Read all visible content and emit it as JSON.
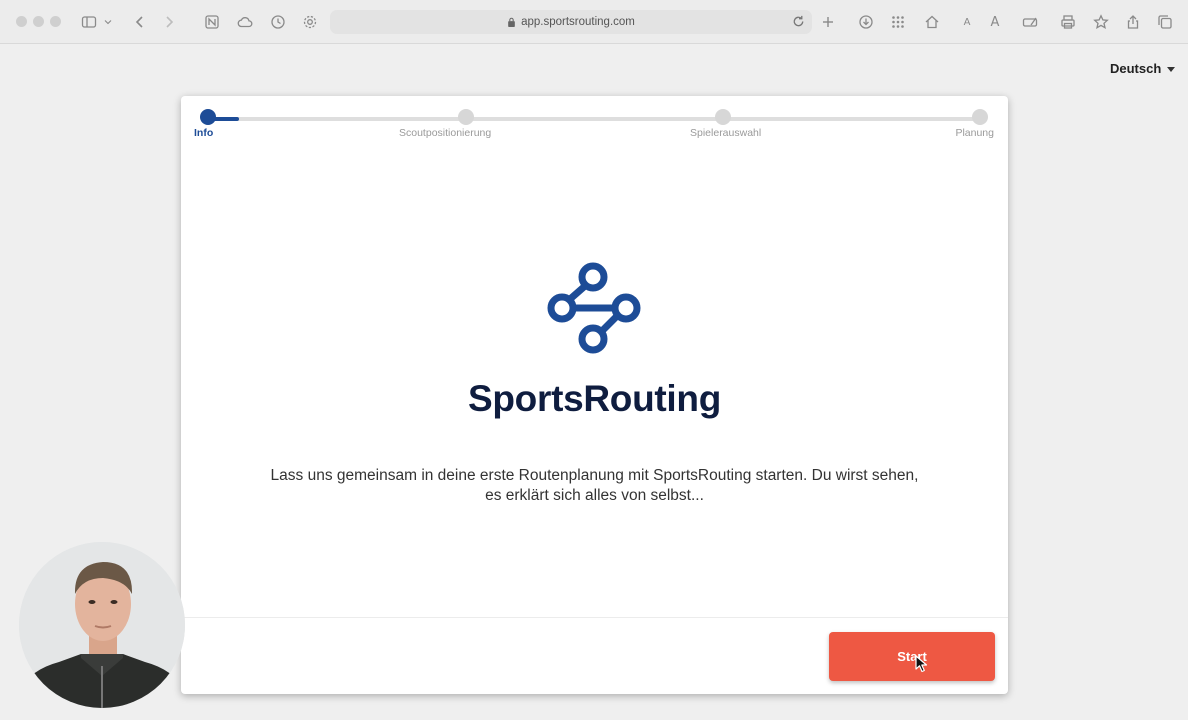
{
  "browser": {
    "url": "app.sportsrouting.com",
    "toolbar_icons": [
      "sidebar-icon",
      "chevron-down-icon",
      "back-icon",
      "forward-icon",
      "notion-icon",
      "cloud-icon",
      "history-icon",
      "gear-icon",
      "reload-icon",
      "new-tab-icon",
      "download-icon",
      "grid-icon",
      "home-icon",
      "text-smaller-icon",
      "text-larger-icon",
      "edit-icon",
      "print-icon",
      "star-icon",
      "share-icon",
      "tabs-icon"
    ]
  },
  "language": {
    "selected": "Deutsch"
  },
  "stepper": {
    "progress": 0.04,
    "steps": [
      {
        "label": "Info",
        "active": true
      },
      {
        "label": "Scoutpositionierung",
        "active": false
      },
      {
        "label": "Spielerauswahl",
        "active": false
      },
      {
        "label": "Planung",
        "active": false
      }
    ]
  },
  "hero": {
    "brand_name": "SportsRouting",
    "intro_line1": "Lass uns gemeinsam in deine erste Routenplanung mit SportsRouting starten. Du wirst sehen,",
    "intro_line2": "es erklärt sich alles von selbst..."
  },
  "actions": {
    "start_label": "Start"
  },
  "colors": {
    "brand_blue": "#1d4c97",
    "brand_dark": "#0f1d3f",
    "start_red": "#ee5843",
    "inactive_grey": "#d7d7d7"
  }
}
